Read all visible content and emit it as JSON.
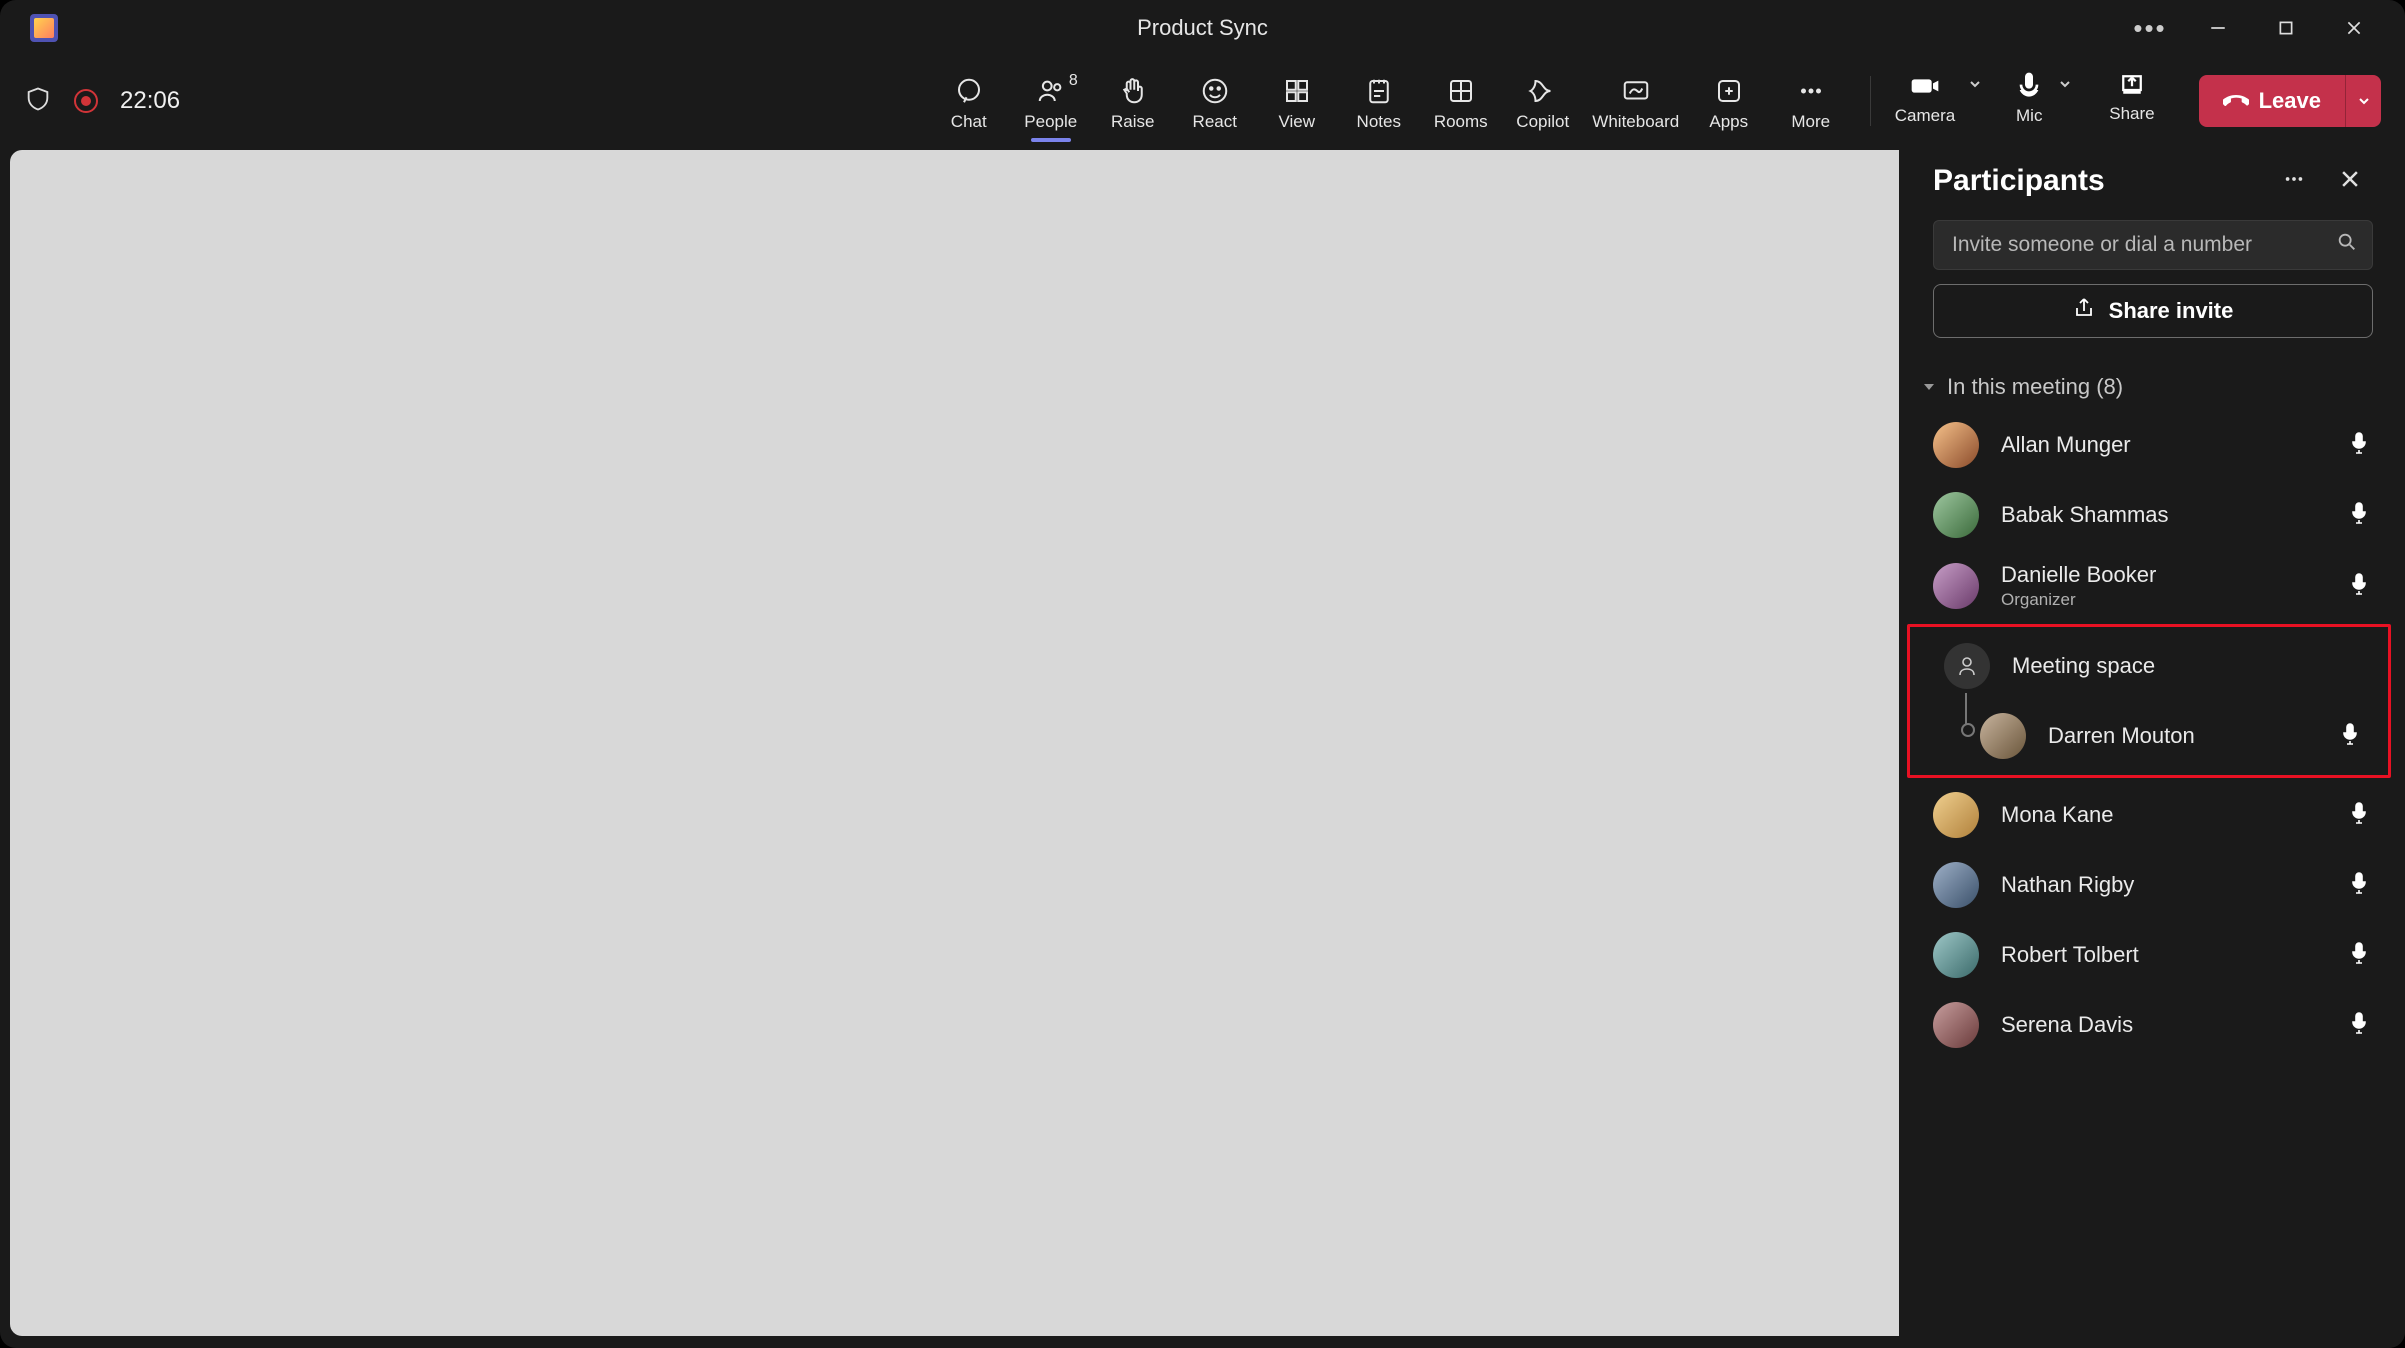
{
  "window": {
    "title": "Product Sync"
  },
  "elapsed": "22:06",
  "toolbar": {
    "chat": "Chat",
    "people": "People",
    "people_count": "8",
    "raise": "Raise",
    "react": "React",
    "view": "View",
    "notes": "Notes",
    "rooms": "Rooms",
    "copilot": "Copilot",
    "whiteboard": "Whiteboard",
    "apps": "Apps",
    "more": "More",
    "camera": "Camera",
    "mic": "Mic",
    "share": "Share",
    "leave": "Leave"
  },
  "panel": {
    "title": "Participants",
    "invite_placeholder": "Invite someone or dial a number",
    "share_invite": "Share invite",
    "section": "In this meeting (8)"
  },
  "participants": {
    "p0": {
      "name": "Allan Munger"
    },
    "p1": {
      "name": "Babak Shammas"
    },
    "p2": {
      "name": "Danielle Booker",
      "role": "Organizer"
    },
    "room": {
      "name": "Meeting space"
    },
    "room_member": {
      "name": "Darren Mouton"
    },
    "p3": {
      "name": "Mona Kane"
    },
    "p4": {
      "name": "Nathan Rigby"
    },
    "p5": {
      "name": "Robert Tolbert"
    },
    "p6": {
      "name": "Serena Davis"
    }
  }
}
